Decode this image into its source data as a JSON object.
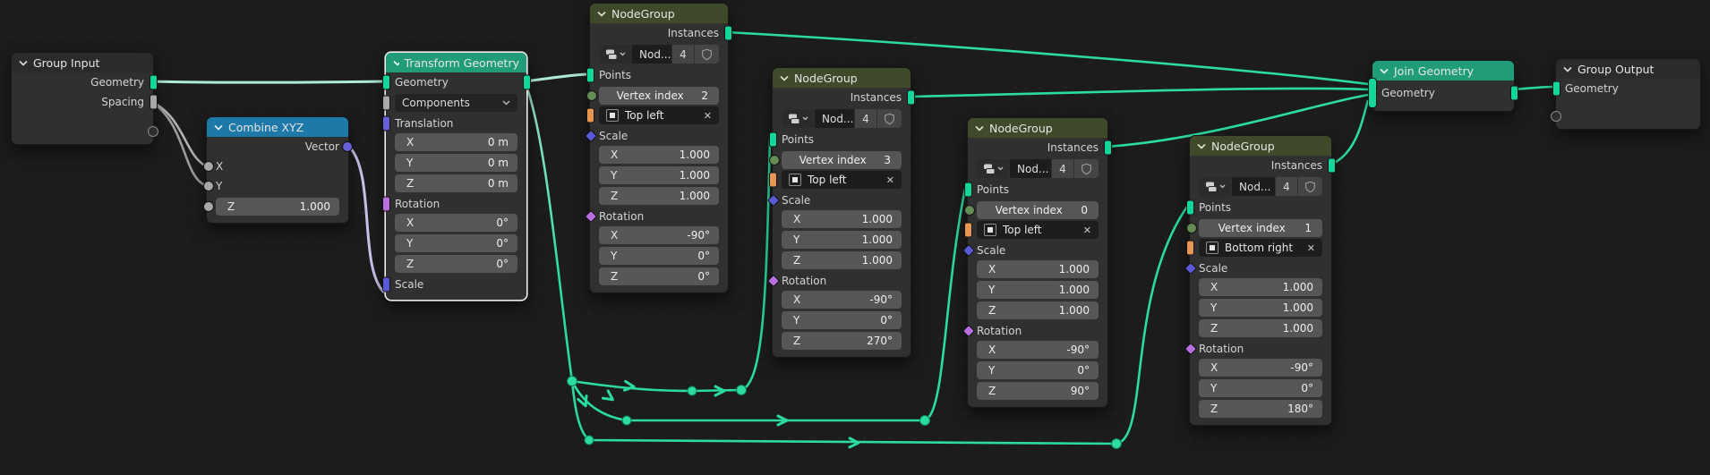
{
  "editor": {
    "background": "#1c1c1c",
    "wire_color": "#2bdba0",
    "wire_highlight_color": "#aeead4",
    "wire_vector_color": "#c8c3ec",
    "wire_gray_color": "#b3b3b3",
    "selection_color": "#ededed",
    "header_nodegroup_color": "#3e4a2a",
    "header_geometry_color": "#219c78",
    "header_converter_color": "#1f79a8",
    "socket_geometry_color": "#12d69a",
    "socket_object_color": "#e89652",
    "socket_vector_color": "#6661d6",
    "socket_rotation_color": "#b86fe0"
  },
  "icons": {
    "close": "✕"
  },
  "group_input": {
    "title": "Group Input",
    "geometry_label": "Geometry",
    "spacing_label": "Spacing"
  },
  "combine_xyz": {
    "title": "Combine XYZ",
    "vector_label": "Vector",
    "x_label": "X",
    "y_label": "Y",
    "z_label": "Z",
    "z_value": "1.000"
  },
  "transform_geometry": {
    "title": "Transform Geometry",
    "geometry_label": "Geometry",
    "mode_value": "Components",
    "translation_label": "Translation",
    "rotation_label": "Rotation",
    "scale_label": "Scale",
    "translation_rows": [
      {
        "axis": "X",
        "value": "0 m"
      },
      {
        "axis": "Y",
        "value": "0 m"
      },
      {
        "axis": "Z",
        "value": "0 m"
      }
    ],
    "rotation_rows": [
      {
        "axis": "X",
        "value": "0°"
      },
      {
        "axis": "Y",
        "value": "0°"
      },
      {
        "axis": "Z",
        "value": "0°"
      }
    ]
  },
  "nodegroups": [
    {
      "title": "NodeGroup",
      "instances_label": "Instances",
      "tree_name": "Nod...",
      "user_count": "4",
      "points_label": "Points",
      "vertex_index_label": "Vertex index",
      "vertex_index_value": "2",
      "target_value": "Top left",
      "scale_label": "Scale",
      "rotation_label": "Rotation",
      "scale_rows": [
        {
          "axis": "X",
          "value": "1.000"
        },
        {
          "axis": "Y",
          "value": "1.000"
        },
        {
          "axis": "Z",
          "value": "1.000"
        }
      ],
      "rotation_rows": [
        {
          "axis": "X",
          "value": "-90°"
        },
        {
          "axis": "Y",
          "value": "0°"
        },
        {
          "axis": "Z",
          "value": "0°"
        }
      ]
    },
    {
      "title": "NodeGroup",
      "instances_label": "Instances",
      "tree_name": "Nod...",
      "user_count": "4",
      "points_label": "Points",
      "vertex_index_label": "Vertex index",
      "vertex_index_value": "3",
      "target_value": "Top left",
      "scale_label": "Scale",
      "rotation_label": "Rotation",
      "scale_rows": [
        {
          "axis": "X",
          "value": "1.000"
        },
        {
          "axis": "Y",
          "value": "1.000"
        },
        {
          "axis": "Z",
          "value": "1.000"
        }
      ],
      "rotation_rows": [
        {
          "axis": "X",
          "value": "-90°"
        },
        {
          "axis": "Y",
          "value": "0°"
        },
        {
          "axis": "Z",
          "value": "270°"
        }
      ]
    },
    {
      "title": "NodeGroup",
      "instances_label": "Instances",
      "tree_name": "Nod...",
      "user_count": "4",
      "points_label": "Points",
      "vertex_index_label": "Vertex index",
      "vertex_index_value": "0",
      "target_value": "Top left",
      "scale_label": "Scale",
      "rotation_label": "Rotation",
      "scale_rows": [
        {
          "axis": "X",
          "value": "1.000"
        },
        {
          "axis": "Y",
          "value": "1.000"
        },
        {
          "axis": "Z",
          "value": "1.000"
        }
      ],
      "rotation_rows": [
        {
          "axis": "X",
          "value": "-90°"
        },
        {
          "axis": "Y",
          "value": "0°"
        },
        {
          "axis": "Z",
          "value": "90°"
        }
      ]
    },
    {
      "title": "NodeGroup",
      "instances_label": "Instances",
      "tree_name": "Nod...",
      "user_count": "4",
      "points_label": "Points",
      "vertex_index_label": "Vertex index",
      "vertex_index_value": "1",
      "target_value": "Bottom right",
      "scale_label": "Scale",
      "rotation_label": "Rotation",
      "scale_rows": [
        {
          "axis": "X",
          "value": "1.000"
        },
        {
          "axis": "Y",
          "value": "1.000"
        },
        {
          "axis": "Z",
          "value": "1.000"
        }
      ],
      "rotation_rows": [
        {
          "axis": "X",
          "value": "-90°"
        },
        {
          "axis": "Y",
          "value": "0°"
        },
        {
          "axis": "Z",
          "value": "180°"
        }
      ]
    }
  ],
  "join_geometry": {
    "title": "Join Geometry",
    "geometry_label": "Geometry"
  },
  "group_output": {
    "title": "Group Output",
    "geometry_label": "Geometry"
  }
}
